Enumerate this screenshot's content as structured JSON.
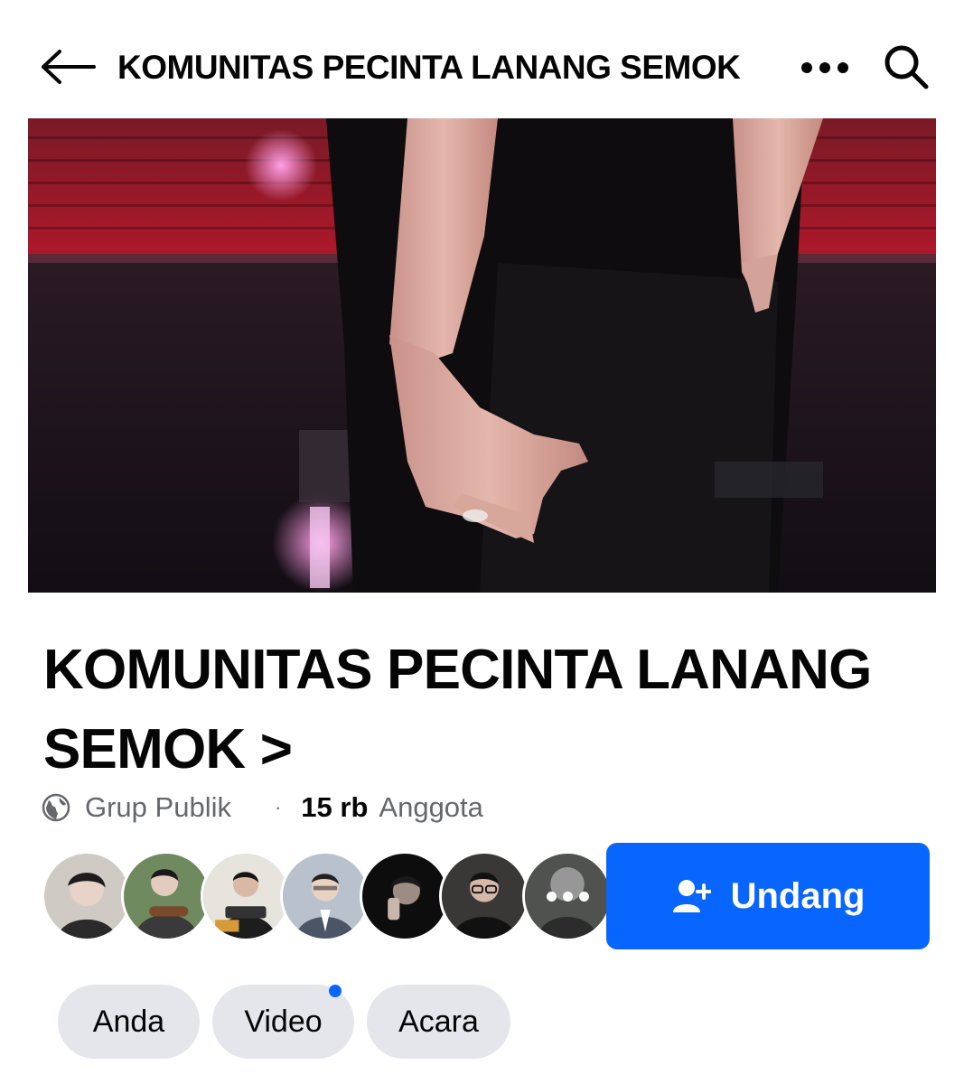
{
  "header": {
    "title": "KOMUNITAS PECINTA LANANG SEMOK",
    "back_icon": "arrow-left-icon",
    "more_icon": "more-horizontal-icon",
    "search_icon": "search-icon"
  },
  "group": {
    "name": "KOMUNITAS PECINTA LANANG SEMOK >",
    "privacy": "Grup Publik",
    "separator": "·",
    "member_count": "15 rb",
    "member_label": "Anggota"
  },
  "invite_button": {
    "label": "Undang",
    "icon": "add-person-icon"
  },
  "tabs": [
    {
      "label": "Anda"
    },
    {
      "label": "Video",
      "has_badge": true
    },
    {
      "label": "Acara"
    }
  ],
  "colors": {
    "accent": "#0866ff",
    "chip_bg": "#e4e6eb",
    "secondary_text": "#65676b"
  }
}
